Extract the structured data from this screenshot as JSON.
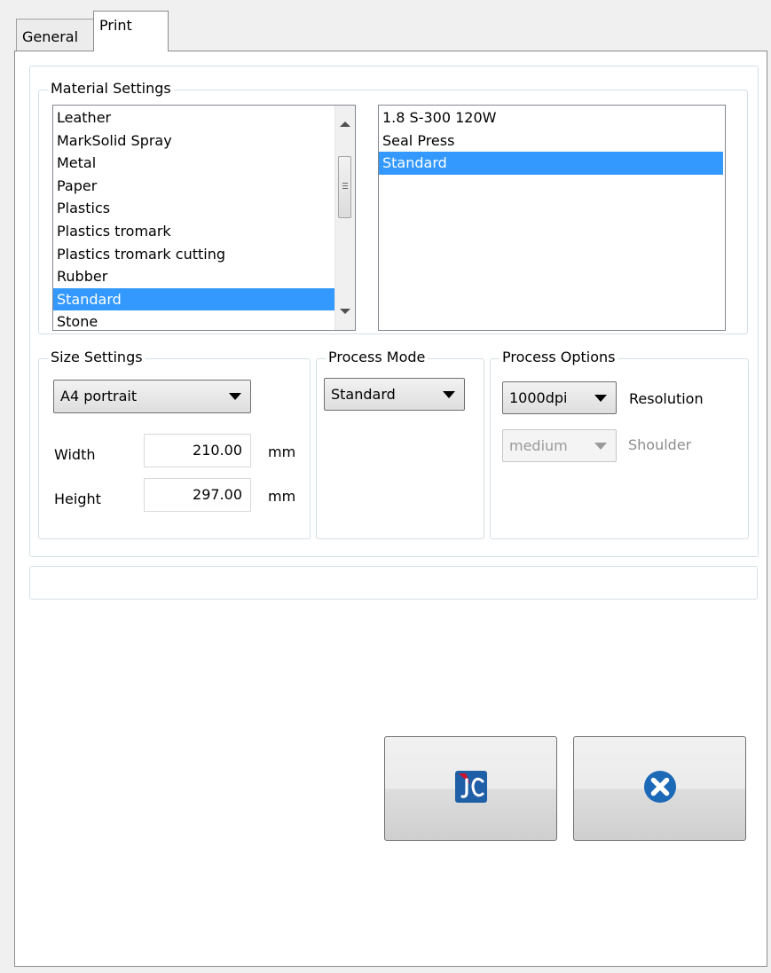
{
  "tabs": [
    {
      "label": "General",
      "active": false
    },
    {
      "label": "Print",
      "active": true
    }
  ],
  "material_settings": {
    "legend": "Material Settings",
    "materials": [
      "Leather",
      "MarkSolid Spray",
      "Metal",
      "Paper",
      "Plastics",
      "Plastics tromark",
      "Plastics tromark cutting",
      "Rubber",
      "Standard",
      "Stone"
    ],
    "selected_material": "Standard",
    "presets": [
      "1.8 S-300 120W",
      "Seal Press",
      "Standard"
    ],
    "selected_preset": "Standard"
  },
  "size_settings": {
    "legend": "Size Settings",
    "paper_size": "A4 portrait",
    "width_label": "Width",
    "width_value": "210.00",
    "height_label": "Height",
    "height_value": "297.00",
    "unit": "mm"
  },
  "process_mode": {
    "legend": "Process Mode",
    "value": "Standard"
  },
  "process_options": {
    "legend": "Process Options",
    "resolution_value": "1000dpi",
    "resolution_label": "Resolution",
    "shoulder_value": "medium",
    "shoulder_label": "Shoulder",
    "shoulder_enabled": false
  },
  "buttons": {
    "ok_icon": "jc-logo-icon",
    "cancel_icon": "close-circle-icon"
  },
  "colors": {
    "selection": "#3399ff",
    "logo_blue": "#1f5fa8",
    "logo_red": "#d0112b",
    "cancel_icon": "#1c69b8"
  }
}
